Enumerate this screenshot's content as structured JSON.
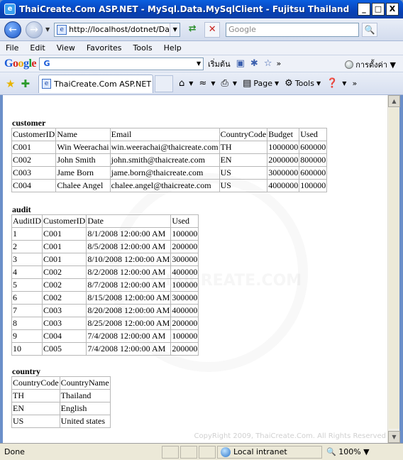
{
  "window": {
    "title": "ThaiCreate.Com ASP.NET - MySql.Data.MySqlClient - Fujitsu Thailand",
    "min": "_",
    "max": "□",
    "close": "X"
  },
  "address_bar": {
    "url": "http://localhost/dotnet/DataS",
    "search_placeholder": "Google"
  },
  "menu": [
    "File",
    "Edit",
    "View",
    "Favorites",
    "Tools",
    "Help"
  ],
  "google_toolbar": {
    "logo": [
      "G",
      "o",
      "o",
      "g",
      "l",
      "e"
    ],
    "search_prefix": "G",
    "start_label": "เริ่มต้น",
    "more": "»",
    "settings_label": "การตั้งค่า"
  },
  "tab_bar": {
    "tab_label": "ThaiCreate.Com ASP.NET ...",
    "page_label": "Page",
    "tools_label": "Tools",
    "more": "»"
  },
  "content": {
    "watermark": "THAICREATE.COM",
    "copyright": "CopyRight 2009, ThaiCreate.Com. All Rights Reserved",
    "customer": {
      "title": "customer",
      "headers": [
        "CustomerID",
        "Name",
        "Email",
        "CountryCode",
        "Budget",
        "Used"
      ],
      "rows": [
        [
          "C001",
          "Win Weerachai",
          "win.weerachai@thaicreate.com",
          "TH",
          "1000000",
          "600000"
        ],
        [
          "C002",
          "John Smith",
          "john.smith@thaicreate.com",
          "EN",
          "2000000",
          "800000"
        ],
        [
          "C003",
          "Jame Born",
          "jame.born@thaicreate.com",
          "US",
          "3000000",
          "600000"
        ],
        [
          "C004",
          "Chalee Angel",
          "chalee.angel@thaicreate.com",
          "US",
          "4000000",
          "100000"
        ]
      ]
    },
    "audit": {
      "title": "audit",
      "headers": [
        "AuditID",
        "CustomerID",
        "Date",
        "Used"
      ],
      "rows": [
        [
          "1",
          "C001",
          "8/1/2008 12:00:00 AM",
          "100000"
        ],
        [
          "2",
          "C001",
          "8/5/2008 12:00:00 AM",
          "200000"
        ],
        [
          "3",
          "C001",
          "8/10/2008 12:00:00 AM",
          "300000"
        ],
        [
          "4",
          "C002",
          "8/2/2008 12:00:00 AM",
          "400000"
        ],
        [
          "5",
          "C002",
          "8/7/2008 12:00:00 AM",
          "100000"
        ],
        [
          "6",
          "C002",
          "8/15/2008 12:00:00 AM",
          "300000"
        ],
        [
          "7",
          "C003",
          "8/20/2008 12:00:00 AM",
          "400000"
        ],
        [
          "8",
          "C003",
          "8/25/2008 12:00:00 AM",
          "200000"
        ],
        [
          "9",
          "C004",
          "7/4/2008 12:00:00 AM",
          "100000"
        ],
        [
          "10",
          "C005",
          "7/4/2008 12:00:00 AM",
          "200000"
        ]
      ]
    },
    "country": {
      "title": "country",
      "headers": [
        "CountryCode",
        "CountryName"
      ],
      "rows": [
        [
          "TH",
          "Thailand"
        ],
        [
          "EN",
          "English"
        ],
        [
          "US",
          "United states"
        ]
      ]
    }
  },
  "status_bar": {
    "status": "Done",
    "zone": "Local intranet",
    "zoom": "100%"
  }
}
